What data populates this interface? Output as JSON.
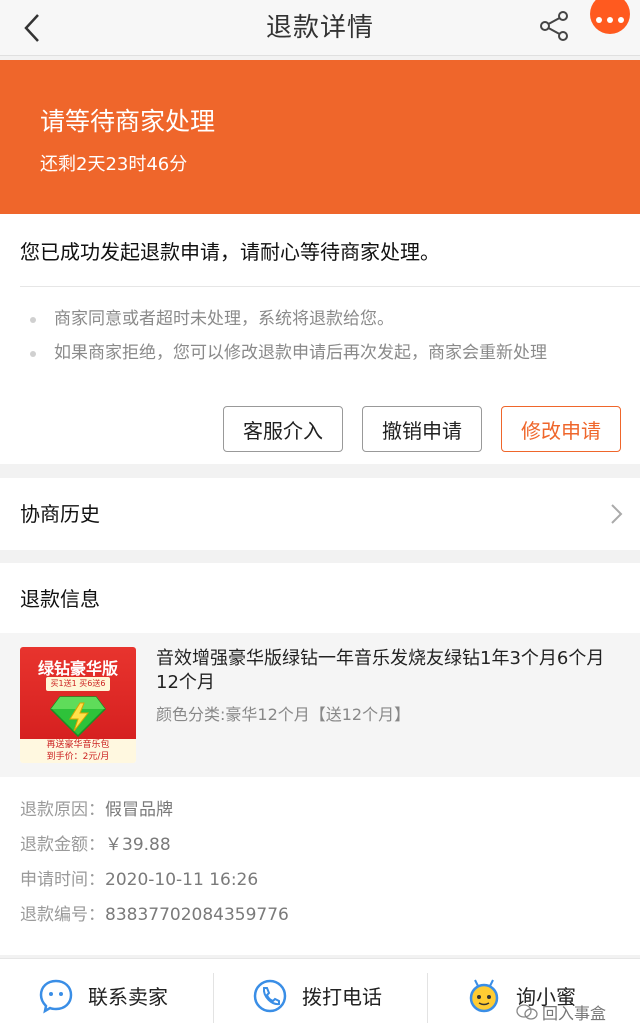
{
  "nav": {
    "title": "退款详情"
  },
  "status": {
    "title": "请等待商家处理",
    "countdown": "还剩2天23时46分"
  },
  "message": {
    "main": "您已成功发起退款申请，请耐心等待商家处理。",
    "tips": [
      "商家同意或者超时未处理，系统将退款给您。",
      "如果商家拒绝，您可以修改退款申请后再次发起，商家会重新处理"
    ]
  },
  "actions": {
    "service": "客服介入",
    "cancel": "撤销申请",
    "modify": "修改申请"
  },
  "history": {
    "label": "协商历史"
  },
  "refund": {
    "title": "退款信息",
    "product": {
      "name": "音效增强豪华版绿钻一年音乐发烧友绿钻1年3个月6个月12个月",
      "spec": "颜色分类:豪华12个月【送12个月】",
      "image_title": "绿钻豪华版",
      "image_sub": "买1送1 买6送6",
      "image_bottom_1": "再送豪华音乐包",
      "image_bottom_2": "到手价：2元/月"
    },
    "details": [
      {
        "label": "退款原因：",
        "value": "假冒品牌"
      },
      {
        "label": "退款金额：",
        "value": "￥39.88"
      },
      {
        "label": "申请时间：",
        "value": "2020-10-11 16:26"
      },
      {
        "label": "退款编号：",
        "value": "83837702084359776"
      }
    ]
  },
  "bottom": {
    "contact": "联系卖家",
    "call": "拨打电话",
    "ask": "询小蜜"
  },
  "watermark": "回入事盒",
  "colors": {
    "accent": "#ef662b",
    "more_button": "#ff5a1f"
  }
}
